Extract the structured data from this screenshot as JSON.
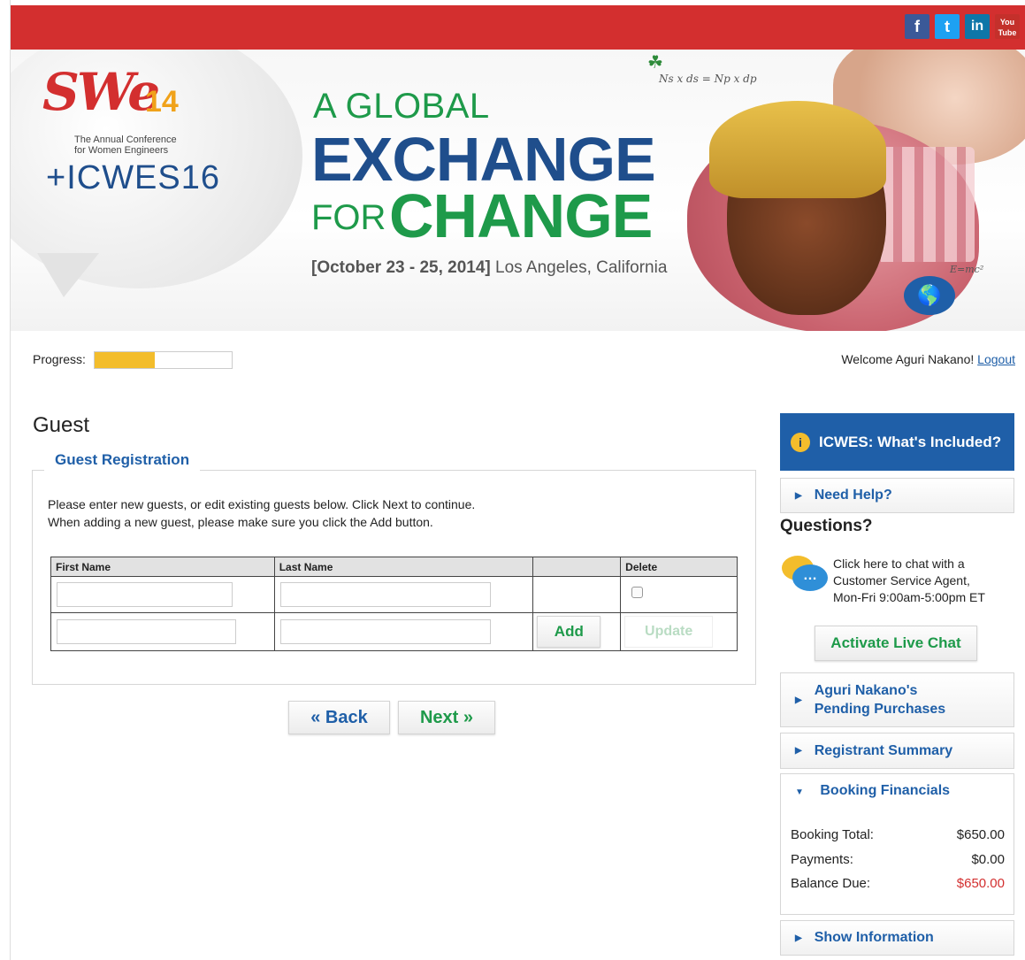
{
  "social": {
    "facebook": "f",
    "twitter": "t",
    "linkedin": "in",
    "youtube": "You Tube"
  },
  "banner": {
    "logo_swe": "SWe",
    "logo_year": "14",
    "logo_annual": "The Annual Conference",
    "logo_women": "for Women Engineers",
    "logo_icwes": "+ICWES16",
    "headline_line1": "A GLOBAL",
    "headline_line2": "EXCHANGE",
    "headline_for": "FOR",
    "headline_change": "CHANGE",
    "date_bold": "[October 23 - 25, 2014]",
    "location": "Los Angeles, California",
    "formula": "Ns x ds = Np x dp",
    "emc": "E=mc²"
  },
  "progress": {
    "label": "Progress:",
    "fraction": 0.44
  },
  "user": {
    "welcome": "Welcome Aguri Nakano!",
    "logout": "Logout"
  },
  "main": {
    "title": "Guest",
    "section_label": "Guest Registration",
    "instructions_line1": "Please enter new guests, or edit existing guests below. Click Next to continue.",
    "instructions_line2": "When adding a new guest, please make sure you click the Add button.",
    "table": {
      "headers": [
        "First Name",
        "Last Name",
        "",
        "Delete"
      ]
    },
    "add_label": "Add",
    "update_label": "Update",
    "back_label": "« Back",
    "next_label": "Next »"
  },
  "sidebar": {
    "included_title": "ICWES: What's Included?",
    "need_help": "Need Help?",
    "questions_title": "Questions?",
    "chat_text_1": "Click here to chat with a",
    "chat_text_2": "Customer Service Agent,",
    "chat_text_3": "Mon-Fri 9:00am-5:00pm ET",
    "live_chat": "Activate Live Chat",
    "pending_1": "Aguri Nakano's",
    "pending_2": "Pending Purchases",
    "registrant_summary": "Registrant Summary",
    "booking_financials": "Booking Financials",
    "booking_total_label": "Booking Total:",
    "booking_total_value": "$650.00",
    "payments_label": "Payments:",
    "payments_value": "$0.00",
    "balance_label": "Balance Due:",
    "balance_value": "$650.00",
    "show_information": "Show Information"
  },
  "colors": {
    "brand_red": "#d32f2f",
    "brand_blue": "#1f5fa8",
    "brand_green": "#1e9a4a",
    "progress_yellow": "#f3bd2c"
  }
}
